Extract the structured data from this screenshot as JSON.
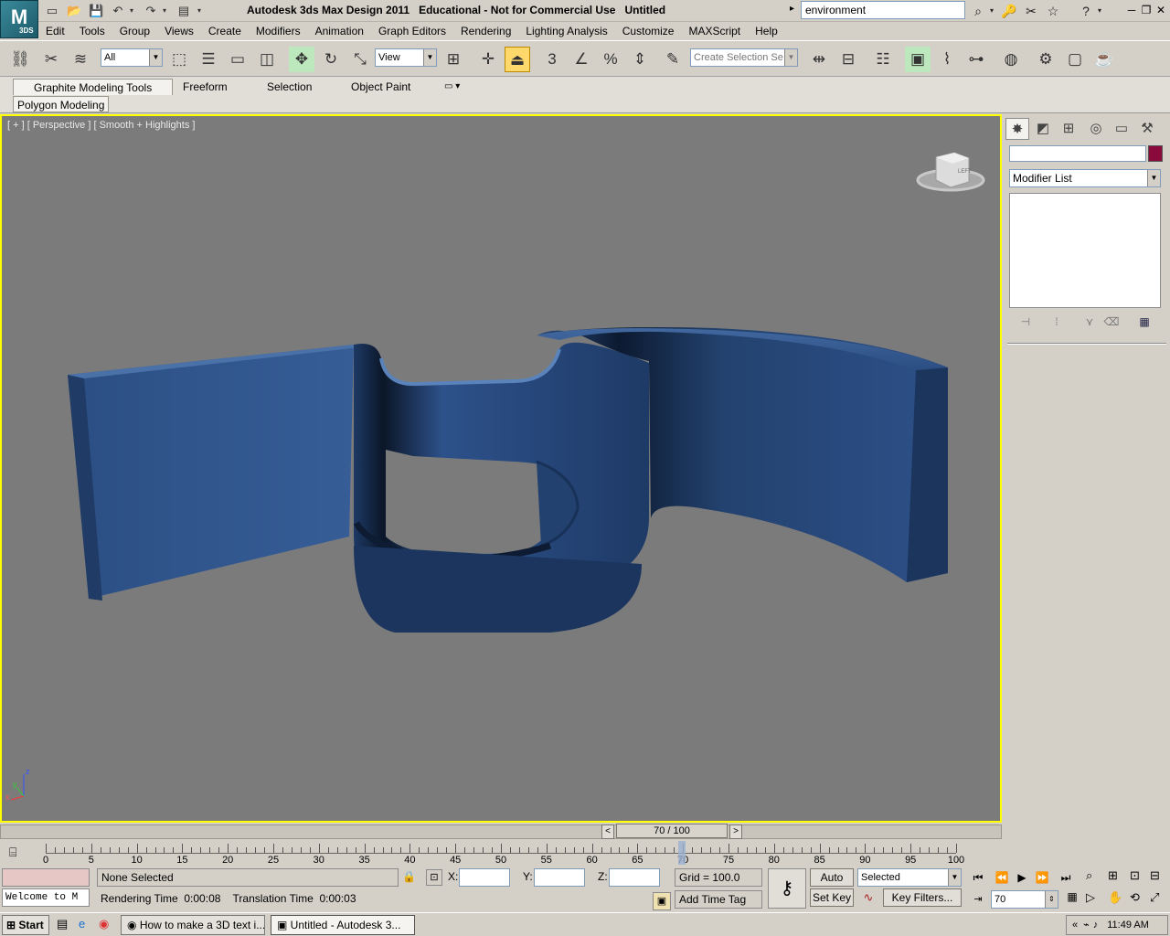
{
  "app": {
    "title": "Autodesk 3ds Max Design 2011   Educational - Not for Commercial Use   Untitled",
    "logo_text": "3DS"
  },
  "search": {
    "value": "environment"
  },
  "menu": [
    "Edit",
    "Tools",
    "Group",
    "Views",
    "Create",
    "Modifiers",
    "Animation",
    "Graph Editors",
    "Rendering",
    "Lighting Analysis",
    "Customize",
    "MAXScript",
    "Help"
  ],
  "toolbar": {
    "selection_filter": "All",
    "ref_coord": "View",
    "named_selection_placeholder": "Create Selection Se",
    "snap_label": "3"
  },
  "ribbon": {
    "tabs": [
      "Graphite Modeling Tools",
      "Freeform",
      "Selection",
      "Object Paint"
    ],
    "active": "Graphite Modeling Tools",
    "panel": "Polygon Modeling"
  },
  "viewport": {
    "label": "[ + ] [ Perspective ] [ Smooth + Highlights ]",
    "viewcube_face": "LEFT",
    "axis": {
      "x": "x",
      "y": "y",
      "z": "z"
    }
  },
  "command_panel": {
    "modifier_list": "Modifier List",
    "swatch_color": "#8b0a3c"
  },
  "time_slider": {
    "display": "70 / 100",
    "current_frame": 70,
    "total_frames": 100,
    "prev": "<",
    "next": ">"
  },
  "track": {
    "labels": [
      "0",
      "5",
      "10",
      "15",
      "20",
      "25",
      "30",
      "35",
      "40",
      "45",
      "50",
      "55",
      "60",
      "65",
      "70",
      "75",
      "80",
      "85",
      "90",
      "95",
      "100"
    ]
  },
  "status": {
    "welcome": "Welcome to M",
    "selection": "None Selected",
    "prompt": "Rendering Time  0:00:08    Translation Time  0:00:03",
    "x_label": "X:",
    "y_label": "Y:",
    "z_label": "Z:",
    "grid": "Grid = 100.0",
    "add_time_tag": "Add Time Tag",
    "auto_key": "Auto Key",
    "set_key": "Set Key",
    "key_mode": "Selected",
    "key_filters": "Key Filters...",
    "frame_field": "70"
  },
  "taskbar": {
    "start": "Start",
    "tasks": [
      "How to make a 3D text i...",
      "Untitled - Autodesk 3..."
    ],
    "time": "11:49 AM"
  }
}
